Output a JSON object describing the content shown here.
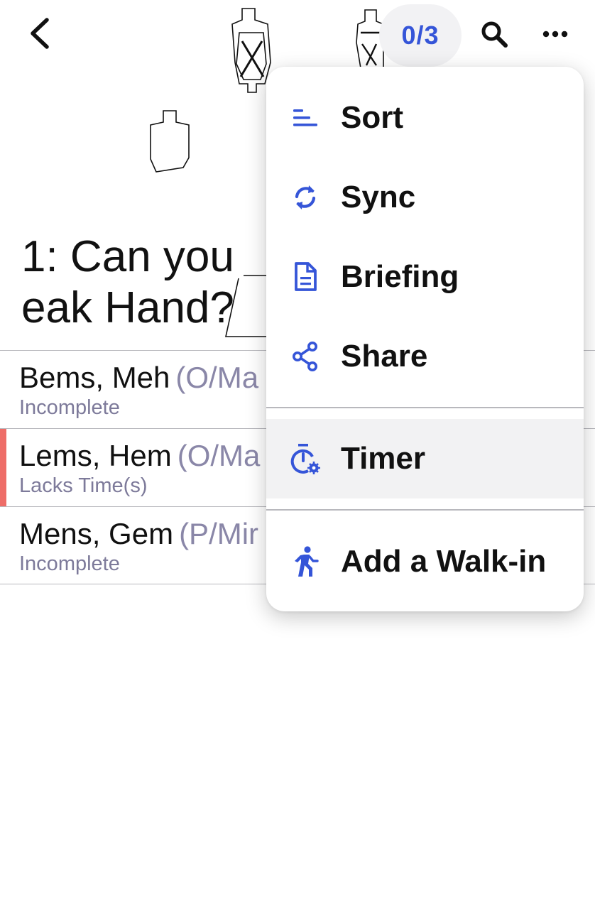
{
  "header": {
    "counter": "0/3"
  },
  "stage": {
    "title_line1": "1: Can you",
    "title_line2": "eak Hand?"
  },
  "competitors": [
    {
      "name": "Bems, Meh",
      "division": "(O/Ma",
      "status": "Incomplete",
      "flagged": false
    },
    {
      "name": "Lems, Hem",
      "division": "(O/Ma",
      "status": "Lacks Time(s)",
      "flagged": true
    },
    {
      "name": "Mens, Gem",
      "division": "(P/Mir",
      "status": "Incomplete",
      "flagged": false
    }
  ],
  "menu": {
    "items": [
      {
        "label": "Sort",
        "icon": "sort-icon"
      },
      {
        "label": "Sync",
        "icon": "sync-icon"
      },
      {
        "label": "Briefing",
        "icon": "document-icon"
      },
      {
        "label": "Share",
        "icon": "share-icon"
      },
      {
        "label": "Timer",
        "icon": "timer-settings-icon"
      },
      {
        "label": "Add a Walk-in",
        "icon": "walking-person-icon"
      }
    ]
  },
  "colors": {
    "accent": "#3555d8",
    "flag": "#ee6d68",
    "muted_text": "#7d7a9a"
  }
}
